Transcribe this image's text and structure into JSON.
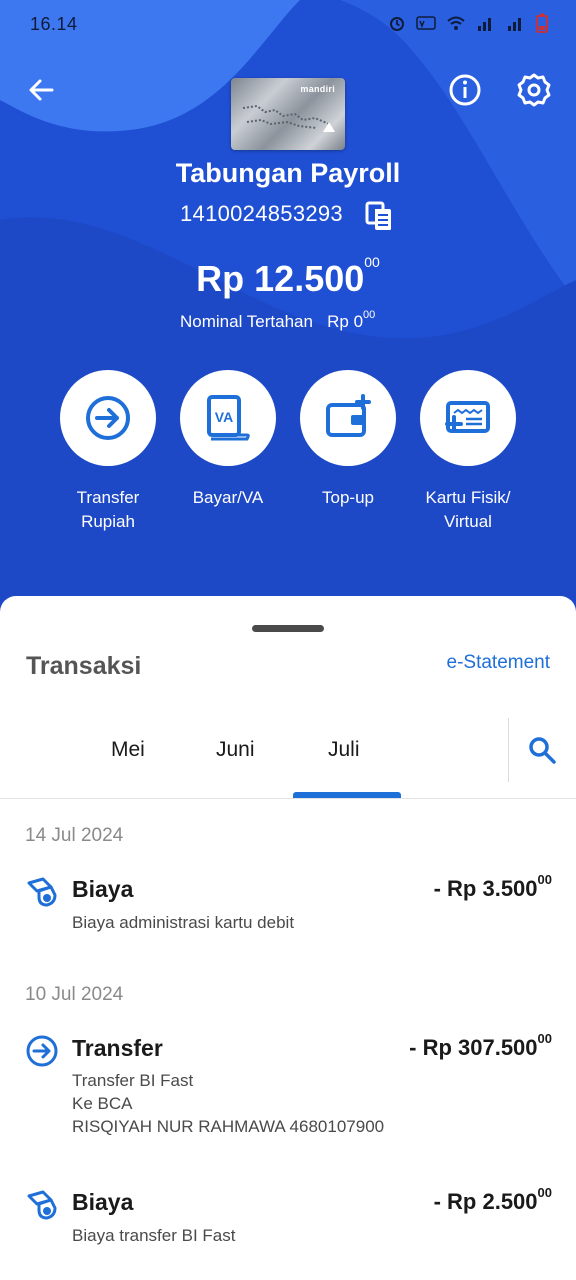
{
  "status_bar": {
    "time": "16.14"
  },
  "colors": {
    "primary": "#1f4fd3",
    "accent": "#1f6fd9",
    "text_dark": "#1a1a1a"
  },
  "account": {
    "name": "Tabungan Payroll",
    "number": "1410024853293",
    "balance_main": "Rp 12.500",
    "balance_cents": "00",
    "hold_label": "Nominal Tertahan",
    "hold_value": "Rp 0",
    "hold_cents": "00",
    "card_brand": "mandiri"
  },
  "actions": [
    {
      "label": "Transfer Rupiah",
      "icon": "transfer-icon"
    },
    {
      "label": "Bayar/VA",
      "icon": "va-icon"
    },
    {
      "label": "Top-up",
      "icon": "wallet-plus-icon"
    },
    {
      "label": "Kartu Fisik/ Virtual",
      "icon": "card-plus-icon"
    }
  ],
  "transactions_panel": {
    "title": "Transaksi",
    "estatement_label": "e-Statement",
    "tabs": [
      "Mei",
      "Juni",
      "Juli"
    ],
    "active_tab": "Juli"
  },
  "transaction_groups": [
    {
      "date": "14 Jul 2024",
      "items": [
        {
          "type": "Biaya",
          "amount": "- Rp 3.500",
          "cents": "00",
          "desc": [
            "Biaya administrasi kartu debit"
          ],
          "icon": "fee-icon"
        }
      ]
    },
    {
      "date": "10 Jul 2024",
      "items": [
        {
          "type": "Transfer",
          "amount": "- Rp 307.500",
          "cents": "00",
          "desc": [
            "Transfer BI Fast",
            "Ke BCA",
            "RISQIYAH NUR RAHMAWA 4680107900"
          ],
          "icon": "transfer-icon"
        },
        {
          "type": "Biaya",
          "amount": "- Rp 2.500",
          "cents": "00",
          "desc": [
            "Biaya transfer BI Fast"
          ],
          "icon": "fee-icon"
        }
      ]
    }
  ]
}
